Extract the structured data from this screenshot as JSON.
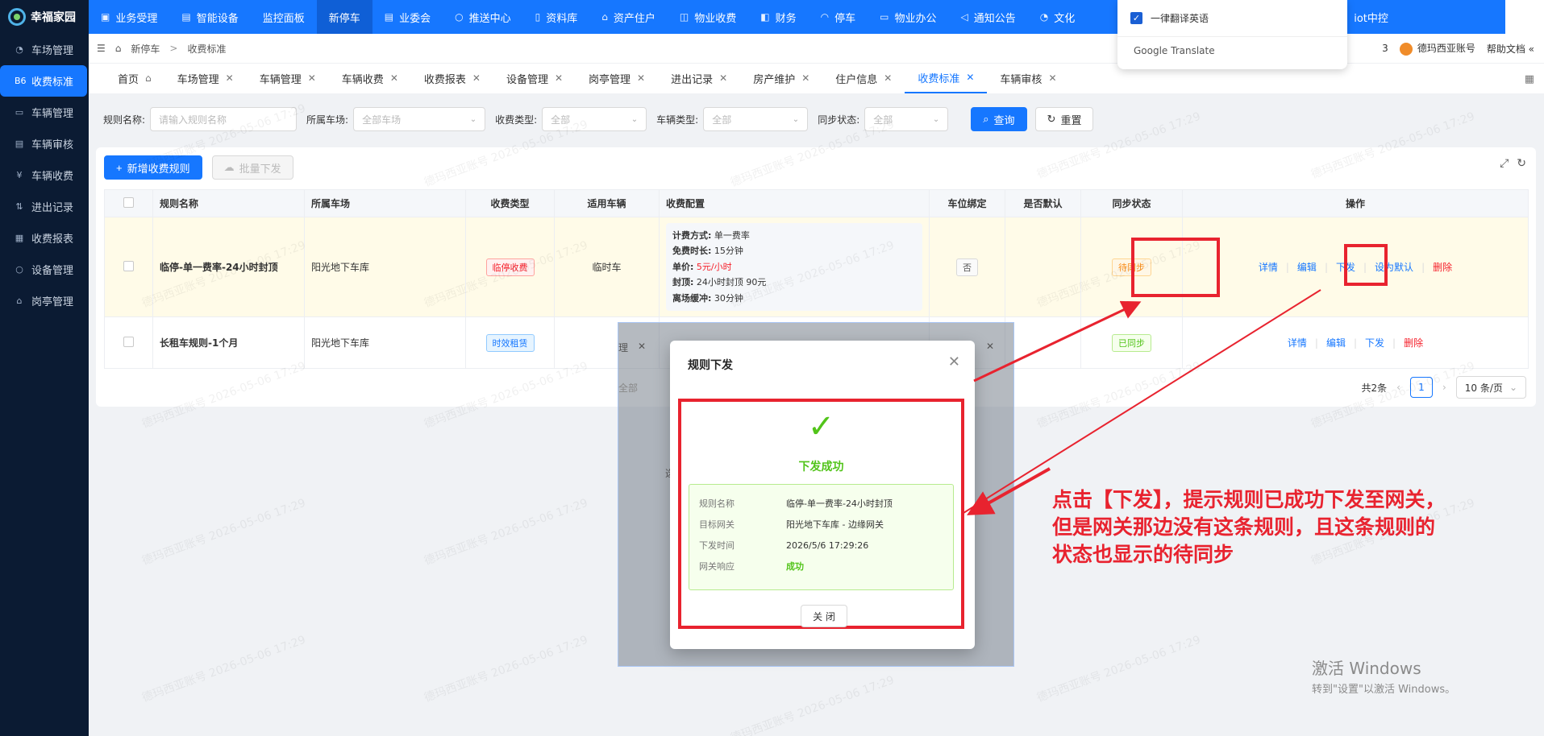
{
  "app": {
    "name": "幸福家园"
  },
  "sidebar": {
    "items": [
      {
        "label": "车场管理",
        "icon": "◔",
        "active": false
      },
      {
        "label": "收费标准",
        "icon": "B6",
        "active": true
      },
      {
        "label": "车辆管理",
        "icon": "▭",
        "active": false
      },
      {
        "label": "车辆审核",
        "icon": "▤",
        "active": false
      },
      {
        "label": "车辆收费",
        "icon": "¥",
        "active": false
      },
      {
        "label": "进出记录",
        "icon": "⇅",
        "active": false
      },
      {
        "label": "收费报表",
        "icon": "▦",
        "active": false
      },
      {
        "label": "设备管理",
        "icon": "○",
        "active": false
      },
      {
        "label": "岗亭管理",
        "icon": "⌂",
        "active": false
      }
    ]
  },
  "topnav": {
    "items": [
      {
        "label": "业务受理",
        "icon": "▣"
      },
      {
        "label": "智能设备",
        "icon": "▤"
      },
      {
        "label": "监控面板",
        "icon": ""
      },
      {
        "label": "新停车",
        "icon": ""
      },
      {
        "label": "业委会",
        "icon": "▤"
      },
      {
        "label": "推送中心",
        "icon": "○"
      },
      {
        "label": "资料库",
        "icon": "▯"
      },
      {
        "label": "资产住户",
        "icon": "⌂"
      },
      {
        "label": "物业收费",
        "icon": "◫"
      },
      {
        "label": "财务",
        "icon": "◧"
      },
      {
        "label": "停车",
        "icon": "◠"
      },
      {
        "label": "物业办公",
        "icon": "▭"
      },
      {
        "label": "通知公告",
        "icon": "◁"
      },
      {
        "label": "文化",
        "icon": "◔"
      },
      {
        "label": "iot中控",
        "icon": ""
      }
    ]
  },
  "translate_popup": {
    "option": "一律翻译英语",
    "brand": "Google Translate"
  },
  "breadcrumb": {
    "parent": "新停车",
    "current": "收费标准"
  },
  "header_right": {
    "fragment": "3",
    "account": "德玛西亚账号",
    "help": "帮助文档 «"
  },
  "tabs": [
    {
      "label": "首页",
      "closable": false,
      "home": true
    },
    {
      "label": "车场管理",
      "closable": true
    },
    {
      "label": "车辆管理",
      "closable": true
    },
    {
      "label": "车辆收费",
      "closable": true
    },
    {
      "label": "收费报表",
      "closable": true
    },
    {
      "label": "设备管理",
      "closable": true
    },
    {
      "label": "岗亭管理",
      "closable": true
    },
    {
      "label": "进出记录",
      "closable": true
    },
    {
      "label": "房产维护",
      "closable": true
    },
    {
      "label": "住户信息",
      "closable": true
    },
    {
      "label": "收费标准",
      "closable": true,
      "active": true
    },
    {
      "label": "车辆审核",
      "closable": true
    }
  ],
  "filters": {
    "rule_name_label": "规则名称:",
    "rule_name_placeholder": "请输入规则名称",
    "lot_label": "所属车场:",
    "lot_value": "全部车场",
    "fee_type_label": "收费类型:",
    "fee_type_value": "全部",
    "vehicle_type_label": "车辆类型:",
    "vehicle_type_value": "全部",
    "sync_label": "同步状态:",
    "sync_value": "全部",
    "search_button": "查询",
    "reset_button": "重置"
  },
  "actions": {
    "add_button": "新增收费规则",
    "batch_button": "批量下发"
  },
  "table": {
    "headers": [
      "规则名称",
      "所属车场",
      "收费类型",
      "适用车辆",
      "收费配置",
      "车位绑定",
      "是否默认",
      "同步状态",
      "操作"
    ],
    "rows": [
      {
        "name": "临停-单一费率-24小时封顶",
        "lot": "阳光地下车库",
        "fee_type": "临停收费",
        "vehicle": "临时车",
        "config": [
          {
            "k": "计费方式:",
            "v": "单一费率"
          },
          {
            "k": "免费时长:",
            "v": "15分钟"
          },
          {
            "k": "单价:",
            "v": "5元/小时"
          },
          {
            "k": "封顶:",
            "v": "24小时封顶 90元"
          },
          {
            "k": "离场缓冲:",
            "v": "30分钟"
          }
        ],
        "bind": "否",
        "default": "",
        "sync": "待同步",
        "ops": [
          "详情",
          "编辑",
          "下发",
          "设为默认",
          "删除"
        ]
      },
      {
        "name": "长租车规则-1个月",
        "lot": "阳光地下车库",
        "fee_type": "时效租赁",
        "vehicle": "",
        "bind": "",
        "default": "",
        "sync": "已同步",
        "ops": [
          "详情",
          "编辑",
          "下发",
          "删除"
        ]
      }
    ]
  },
  "pagination": {
    "total": "共2条",
    "page": "1",
    "size": "10 条/页"
  },
  "modal": {
    "title": "规则下发",
    "status": "下发成功",
    "fields": [
      {
        "k": "规则名称",
        "v": "临停-单一费率-24小时封顶"
      },
      {
        "k": "目标网关",
        "v": "阳光地下车库 - 边缘网关"
      },
      {
        "k": "下发时间",
        "v": "2026/5/6 17:29:26"
      },
      {
        "k": "网关响应",
        "v": "成功"
      }
    ],
    "close_button": "关 闭"
  },
  "background_fragments": {
    "a": "理",
    "b": "全部",
    "c": "选"
  },
  "annotation": {
    "lines": [
      "点击【下发】，提示规则已成功下发至网关，",
      "但是网关那边没有这条规则，且这条规则的",
      "状态也显示的待同步"
    ]
  },
  "watermark": "德玛西亚账号 2026-05-06 17:29",
  "windows_activation": {
    "line1": "激活 Windows",
    "line2": "转到\"设置\"以激活 Windows。"
  },
  "colors": {
    "primary": "#1677ff",
    "sidebar": "#0b1b33",
    "annotation_red": "#e8232f",
    "success": "#52c41a"
  }
}
